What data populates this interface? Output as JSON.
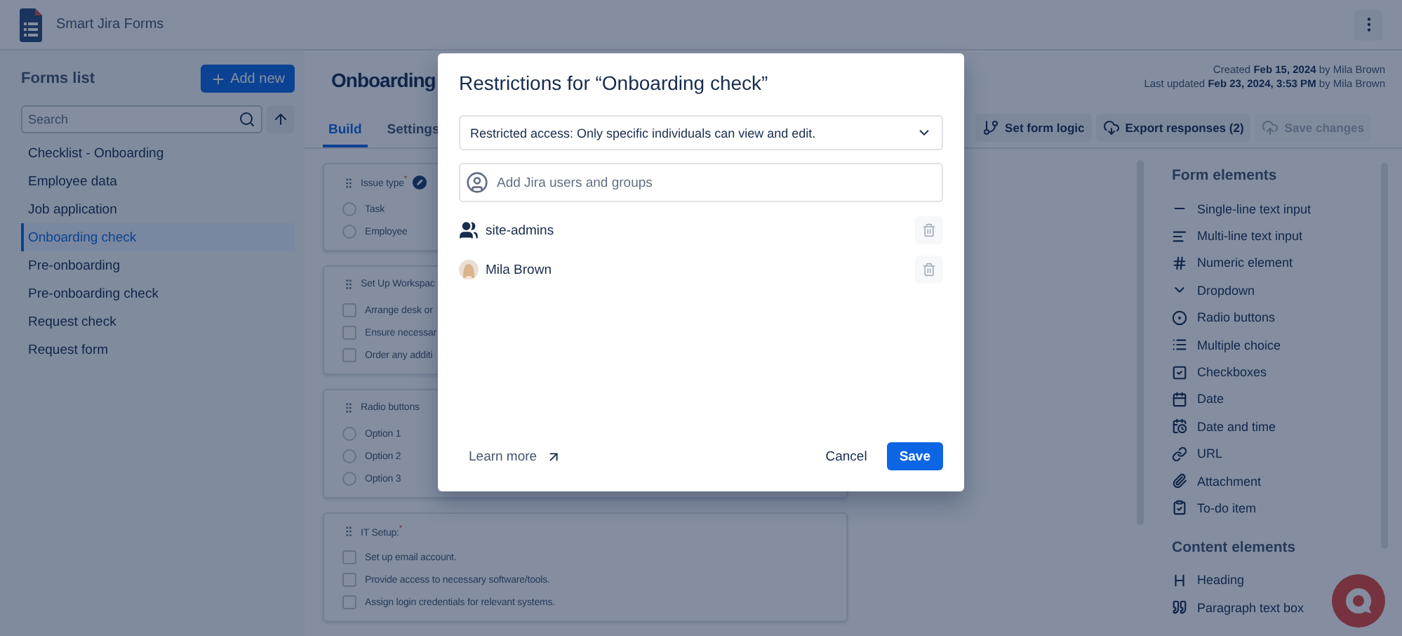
{
  "app": {
    "title": "Smart Jira Forms"
  },
  "sidebar": {
    "title": "Forms list",
    "add_button": "Add new",
    "search": {
      "placeholder": "Search"
    },
    "items": [
      {
        "label": "Checklist - Onboarding",
        "selected": false
      },
      {
        "label": "Employee data",
        "selected": false
      },
      {
        "label": "Job application",
        "selected": false
      },
      {
        "label": "Onboarding check",
        "selected": true
      },
      {
        "label": "Pre-onboarding",
        "selected": false
      },
      {
        "label": "Pre-onboarding check",
        "selected": false
      },
      {
        "label": "Request check",
        "selected": false
      },
      {
        "label": "Request form",
        "selected": false
      }
    ]
  },
  "form": {
    "title": "Onboarding",
    "meta": [
      "Created **Feb 15, 2024** by Mila Brown",
      "Last updated **Feb 23, 2024, 3:53 PM** by Mila Brown"
    ],
    "tabs": [
      {
        "label": "Build",
        "selected": true
      },
      {
        "label": "Settings",
        "selected": false
      }
    ],
    "actions": [
      {
        "kind": "logic",
        "label": "Set form logic",
        "disabled": false
      },
      {
        "kind": "export",
        "label": "Export responses (2)",
        "disabled": false
      },
      {
        "kind": "save",
        "label": "Save changes",
        "disabled": true
      }
    ],
    "fields": [
      {
        "kind": "radio",
        "label": "Issue type$^{*}$",
        "system": true,
        "options": [
          {
            "label": "Task",
            "checked": false
          },
          {
            "label": "Employee",
            "checked": false
          }
        ]
      },
      {
        "kind": "checkbox",
        "label": "Set Up Workspac",
        "system": false,
        "options": [
          {
            "label": "Arrange desk or",
            "checked": false
          },
          {
            "label": "Ensure necessar",
            "checked": false
          },
          {
            "label": "Order any additi",
            "checked": false
          }
        ]
      },
      {
        "kind": "radio",
        "label": "Radio buttons",
        "system": false,
        "options": [
          {
            "label": "Option 1",
            "checked": false
          },
          {
            "label": "Option 2",
            "checked": false
          },
          {
            "label": "Option 3",
            "checked": false
          }
        ]
      },
      {
        "kind": "checkbox",
        "label": "IT Setup:$^{*}$",
        "system": false,
        "options": [
          {
            "label": "Set up email account.",
            "checked": false
          },
          {
            "label": "Provide access to necessary software/tools.",
            "checked": false
          },
          {
            "label": "Assign login credentials for relevant systems.",
            "checked": false
          }
        ]
      }
    ]
  },
  "elements": [
    {
      "title": "Form elements",
      "items": [
        {
          "kind": "short",
          "label": "Single-line text input"
        },
        {
          "kind": "long",
          "label": "Multi-line text input"
        },
        {
          "kind": "number",
          "label": "Numeric element"
        },
        {
          "kind": "dropdown",
          "label": "Dropdown"
        },
        {
          "kind": "radio",
          "label": "Radio buttons"
        },
        {
          "kind": "multi",
          "label": "Multiple choice"
        },
        {
          "kind": "checkbox",
          "label": "Checkboxes"
        },
        {
          "kind": "date",
          "label": "Date"
        },
        {
          "kind": "datetime",
          "label": "Date and time"
        },
        {
          "kind": "url",
          "label": "URL"
        },
        {
          "kind": "attachment",
          "label": "Attachment"
        },
        {
          "kind": "todo",
          "label": "To-do item"
        }
      ]
    },
    {
      "title": "Content elements",
      "items": [
        {
          "kind": "heading",
          "label": "Heading"
        },
        {
          "kind": "paragraph",
          "label": "Paragraph text box"
        }
      ]
    }
  ],
  "dialog": {
    "title": "Restrictions for “Onboarding check”",
    "access": "Restricted access: Only specific individuals can view and edit.",
    "add_placeholder": "Add Jira users and groups",
    "members": [
      {
        "kind": "group",
        "name": "site-admins"
      },
      {
        "kind": "user",
        "name": "Mila Brown"
      }
    ],
    "learn_more": "Learn more",
    "cancel": "Cancel",
    "save": "Save"
  }
}
